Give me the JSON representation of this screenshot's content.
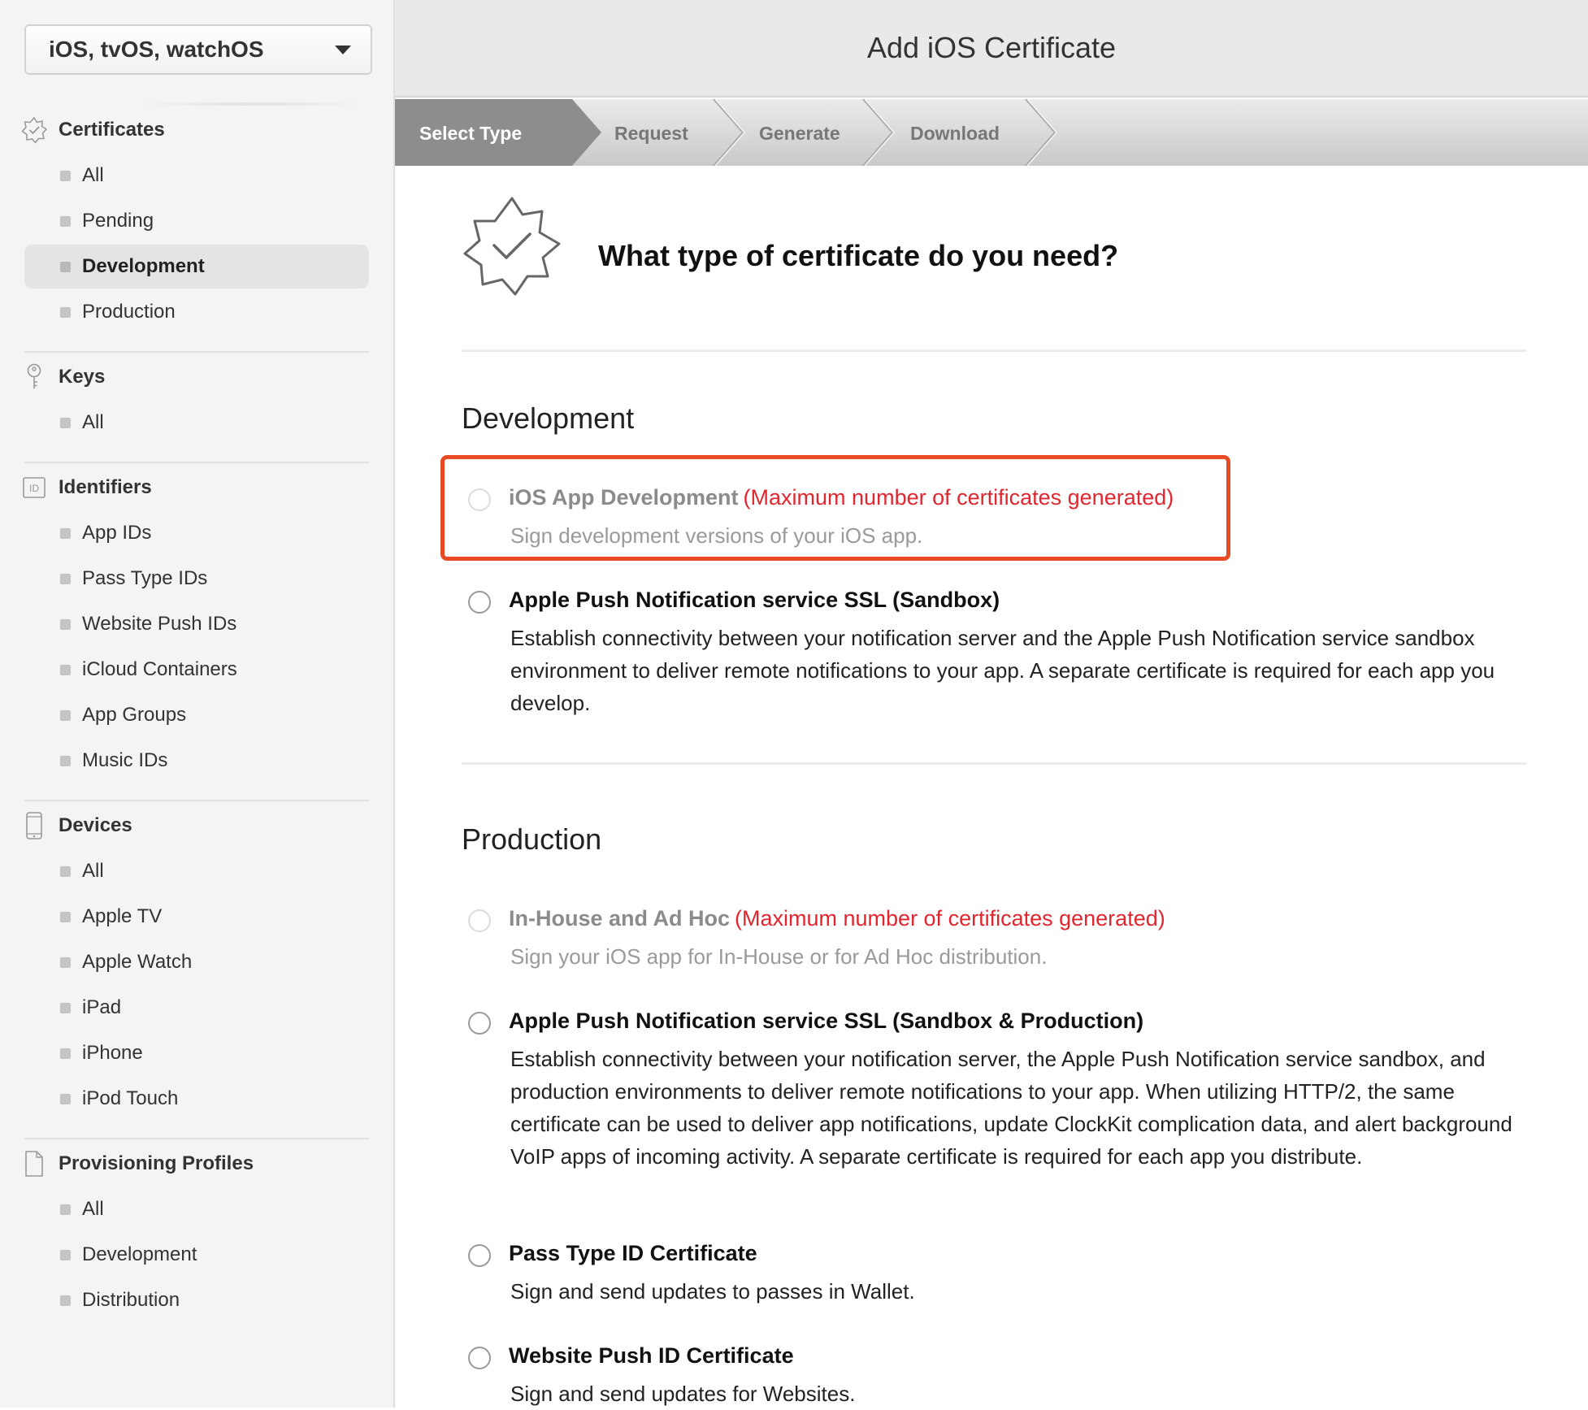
{
  "sidebar": {
    "platform": "iOS, tvOS, watchOS",
    "sections": [
      {
        "title": "Certificates",
        "items": [
          "All",
          "Pending",
          "Development",
          "Production"
        ],
        "active": "Development"
      },
      {
        "title": "Keys",
        "items": [
          "All"
        ]
      },
      {
        "title": "Identifiers",
        "icon_text": "ID",
        "items": [
          "App IDs",
          "Pass Type IDs",
          "Website Push IDs",
          "iCloud Containers",
          "App Groups",
          "Music IDs"
        ]
      },
      {
        "title": "Devices",
        "items": [
          "All",
          "Apple TV",
          "Apple Watch",
          "iPad",
          "iPhone",
          "iPod Touch"
        ]
      },
      {
        "title": "Provisioning Profiles",
        "items": [
          "All",
          "Development",
          "Distribution"
        ]
      }
    ]
  },
  "header": {
    "title": "Add iOS Certificate"
  },
  "steps": [
    "Select Type",
    "Request",
    "Generate",
    "Download"
  ],
  "active_step": "Select Type",
  "question": "What type of certificate do you need?",
  "development": {
    "title": "Development",
    "options": [
      {
        "title": "iOS App Development",
        "warning": "(Maximum number of certificates generated)",
        "description": "Sign development versions of your iOS app.",
        "disabled": true
      },
      {
        "title": "Apple Push Notification service SSL (Sandbox)",
        "description": "Establish connectivity between your notification server and the Apple Push Notification service sandbox environment to deliver remote notifications to your app. A separate certificate is required for each app you develop."
      }
    ]
  },
  "production": {
    "title": "Production",
    "options": [
      {
        "title": "In-House and Ad Hoc",
        "warning": "(Maximum number of certificates generated)",
        "description": "Sign your iOS app for In-House or for Ad Hoc distribution.",
        "disabled": true
      },
      {
        "title": "Apple Push Notification service SSL (Sandbox & Production)",
        "description": "Establish connectivity between your notification server, the Apple Push Notification service sandbox, and production environments to deliver remote notifications to your app. When utilizing HTTP/2, the same certificate can be used to deliver app notifications, update ClockKit complication data, and alert background VoIP apps of incoming activity. A separate certificate is required for each app you distribute."
      },
      {
        "title": "Pass Type ID Certificate",
        "description": "Sign and send updates to passes in Wallet."
      },
      {
        "title": "Website Push ID Certificate",
        "description": "Sign and send updates for Websites."
      }
    ]
  },
  "colors": {
    "warning": "#e0262f",
    "highlight_box": "#e84a25",
    "active_step": "#8d8d8d"
  }
}
